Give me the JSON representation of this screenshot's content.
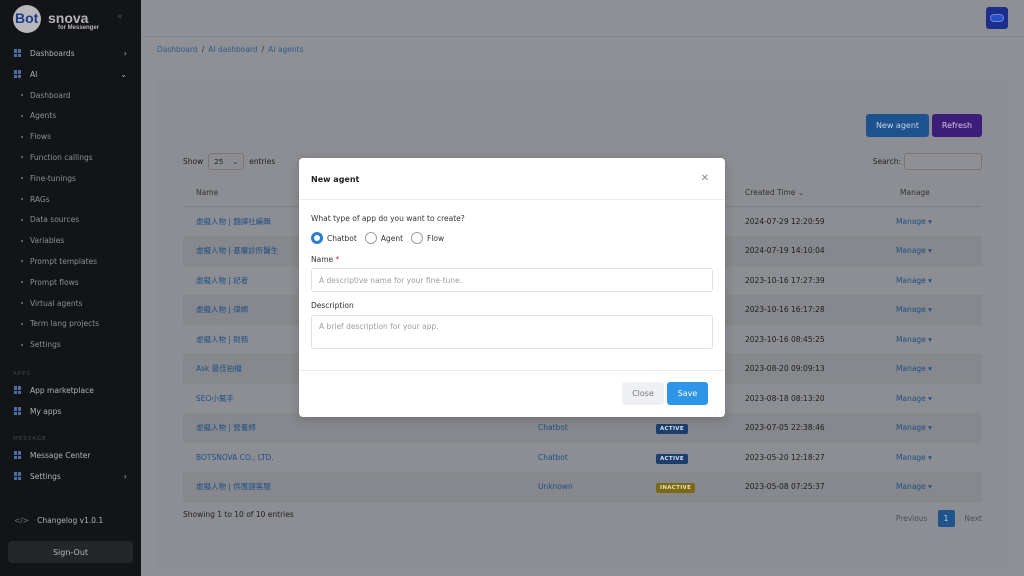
{
  "logo": {
    "part1": "Bot",
    "part2": "snova",
    "sub": "for Messenger"
  },
  "sidebar": {
    "items": [
      {
        "label": "Dashboards",
        "chevron": "›"
      },
      {
        "label": "AI",
        "chevron": "⌄"
      }
    ],
    "ai_sub": [
      "Dashboard",
      "Agents",
      "Flows",
      "Function callings",
      "Fine-tunings",
      "RAGs",
      "Data sources",
      "Variables",
      "Prompt templates",
      "Prompt flows",
      "Virtual agents",
      "Term lang projects",
      "Settings"
    ],
    "apps_label": "APPS",
    "apps": [
      "App marketplace",
      "My apps"
    ],
    "message_label": "MESSAGE",
    "message": [
      "Message Center",
      "Settings"
    ],
    "changelog": "Changelog v1.0.1",
    "signout": "Sign-Out"
  },
  "breadcrumb": [
    "Dashboard",
    "AI dashboard",
    "AI agents"
  ],
  "toolbar": {
    "new_agent": "New agent",
    "refresh": "Refresh"
  },
  "list_controls": {
    "show": "Show",
    "page_size": "25",
    "entries": "entries",
    "search": "Search:"
  },
  "table": {
    "headers": {
      "name": "Name",
      "created": "Created Time",
      "manage": "Manage"
    },
    "rows": [
      {
        "name": "虛擬人物 | 翻譯社編輯",
        "type": "",
        "status": "",
        "created": "2024-07-29 12:20:59",
        "manage": "Manage"
      },
      {
        "name": "虛擬人物 | 基層診所醫生",
        "type": "",
        "status": "",
        "created": "2024-07-19 14:10:04",
        "manage": "Manage"
      },
      {
        "name": "虛擬人物 | 記者",
        "type": "",
        "status": "",
        "created": "2023-10-16 17:27:39",
        "manage": "Manage"
      },
      {
        "name": "虛擬人物 | 律師",
        "type": "",
        "status": "",
        "created": "2023-10-16 16:17:28",
        "manage": "Manage"
      },
      {
        "name": "虛擬人物 | 財務",
        "type": "",
        "status": "",
        "created": "2023-10-16 08:45:25",
        "manage": "Manage"
      },
      {
        "name": "Ask 最佳拍檔",
        "type": "",
        "status": "",
        "created": "2023-08-20 09:09:13",
        "manage": "Manage"
      },
      {
        "name": "SEO小幫手",
        "type": "",
        "status": "",
        "created": "2023-08-18 08:13:20",
        "manage": "Manage"
      },
      {
        "name": "虛擬人物 | 營養師",
        "type": "Chatbot",
        "status": "ACTIVE",
        "created": "2023-07-05 22:38:46",
        "manage": "Manage"
      },
      {
        "name": "BOTSNOVA CO., LTD.",
        "type": "Chatbot",
        "status": "ACTIVE",
        "created": "2023-05-20 12:18:27",
        "manage": "Manage"
      },
      {
        "name": "虛擬人物 | 供應鏈客服",
        "type": "Unknown",
        "status": "INACTIVE",
        "created": "2023-05-08 07:25:37",
        "manage": "Manage"
      }
    ]
  },
  "footer": {
    "info": "Showing 1 to 10 of 10 entries",
    "previous": "Previous",
    "page": "1",
    "next": "Next"
  },
  "modal": {
    "title": "New agent",
    "question": "What type of app do you want to create?",
    "options": [
      "Chatbot",
      "Agent",
      "Flow"
    ],
    "selected": "Chatbot",
    "name_label": "Name",
    "name_required": "*",
    "name_placeholder": "A descriptive name for your fine-tune.",
    "description_label": "Description",
    "description_placeholder": "A brief description for your app.",
    "close": "Close",
    "save": "Save"
  }
}
